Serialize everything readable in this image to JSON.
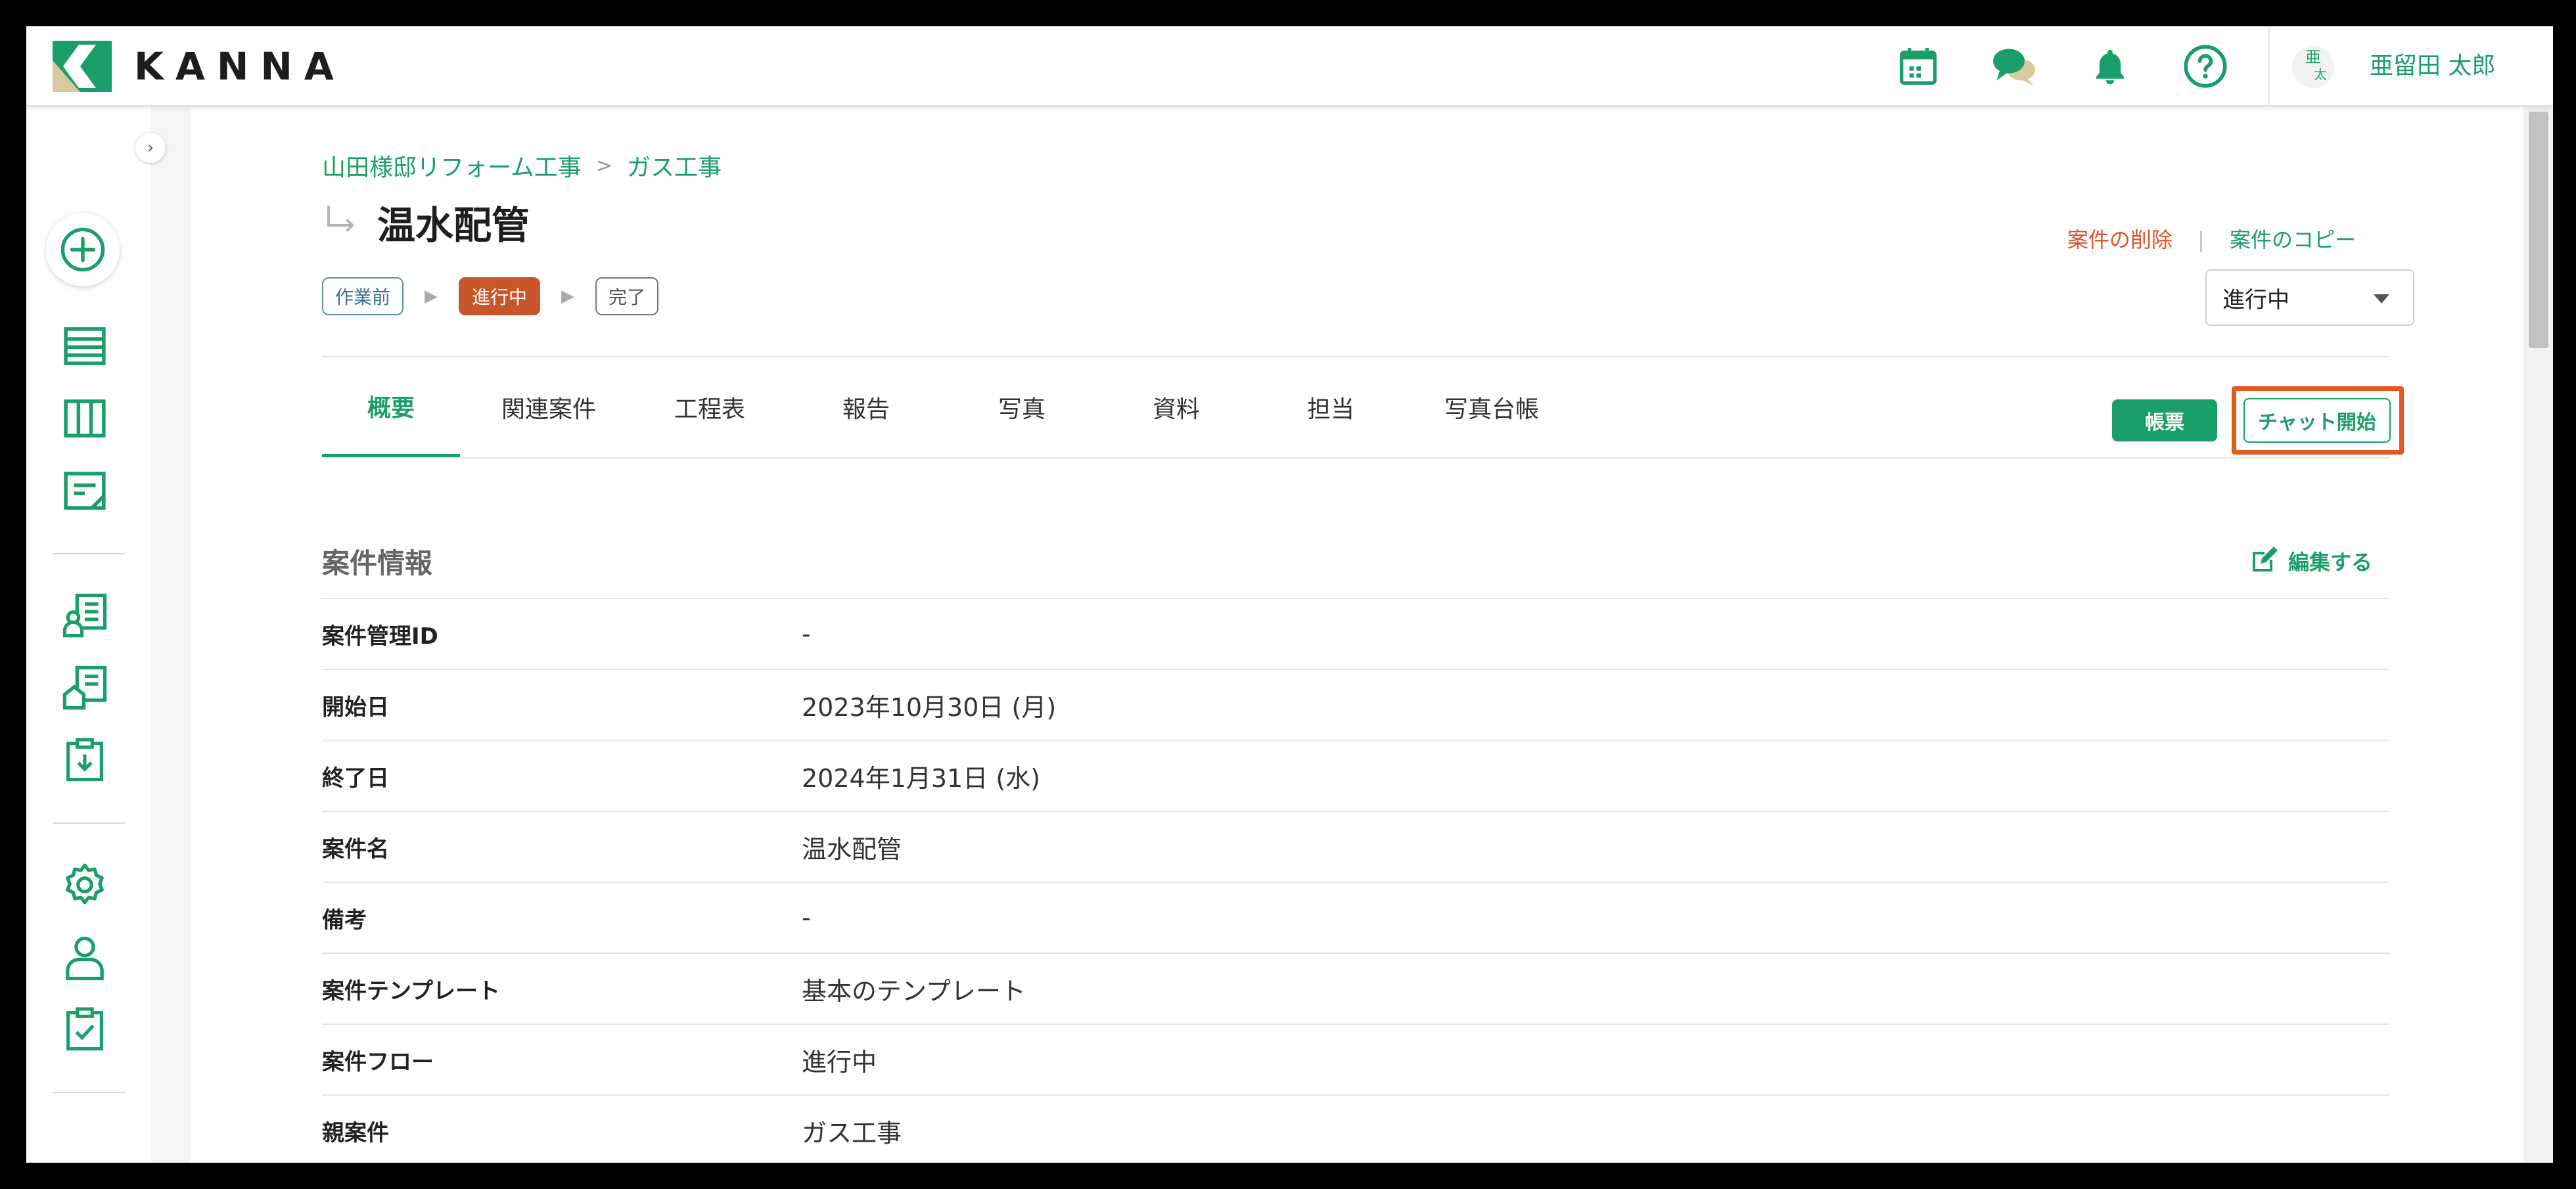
{
  "header": {
    "logo_text": "KANNA",
    "user": {
      "avatar_top": "亜",
      "avatar_bottom": "太",
      "name": "亜留田 太郎"
    },
    "icons": [
      "calendar-icon",
      "chat-icon",
      "bell-icon",
      "help-icon"
    ]
  },
  "sidebar": {
    "icons": [
      "add-icon",
      "list-icon",
      "board-icon",
      "document-icon",
      "client-icon",
      "property-icon",
      "report-download-icon",
      "settings-icon",
      "user-icon",
      "checklist-icon"
    ]
  },
  "breadcrumb": {
    "items": [
      "山田様邸リフォーム工事",
      "ガス工事"
    ],
    "separator": ">"
  },
  "page": {
    "title": "温水配管"
  },
  "actions": {
    "delete": "案件の削除",
    "separator": "|",
    "copy": "案件のコピー"
  },
  "steps": {
    "pre": "作業前",
    "current": "進行中",
    "done": "完了"
  },
  "status_select": {
    "value": "進行中"
  },
  "tabs": [
    {
      "label": "概要",
      "active": true
    },
    {
      "label": "関連案件"
    },
    {
      "label": "工程表"
    },
    {
      "label": "報告"
    },
    {
      "label": "写真"
    },
    {
      "label": "資料"
    },
    {
      "label": "担当"
    },
    {
      "label": "写真台帳"
    }
  ],
  "buttons": {
    "ledger": "帳票",
    "chat": "チャット開始"
  },
  "section": {
    "title": "案件情報",
    "edit": "編集する"
  },
  "info_rows": [
    {
      "label": "案件管理ID",
      "value": "-"
    },
    {
      "label": "開始日",
      "value": "2023年10月30日 (月)"
    },
    {
      "label": "終了日",
      "value": "2024年1月31日 (水)"
    },
    {
      "label": "案件名",
      "value": "温水配管"
    },
    {
      "label": "備考",
      "value": "-"
    },
    {
      "label": "案件テンプレート",
      "value": "基本のテンプレート"
    },
    {
      "label": "案件フロー",
      "value": "進行中"
    },
    {
      "label": "親案件",
      "value": "ガス工事"
    }
  ],
  "colors": {
    "brand": "#1a9e6a",
    "danger": "#e0542a",
    "status_current": "#c7562a",
    "highlight": "#e2581f"
  }
}
